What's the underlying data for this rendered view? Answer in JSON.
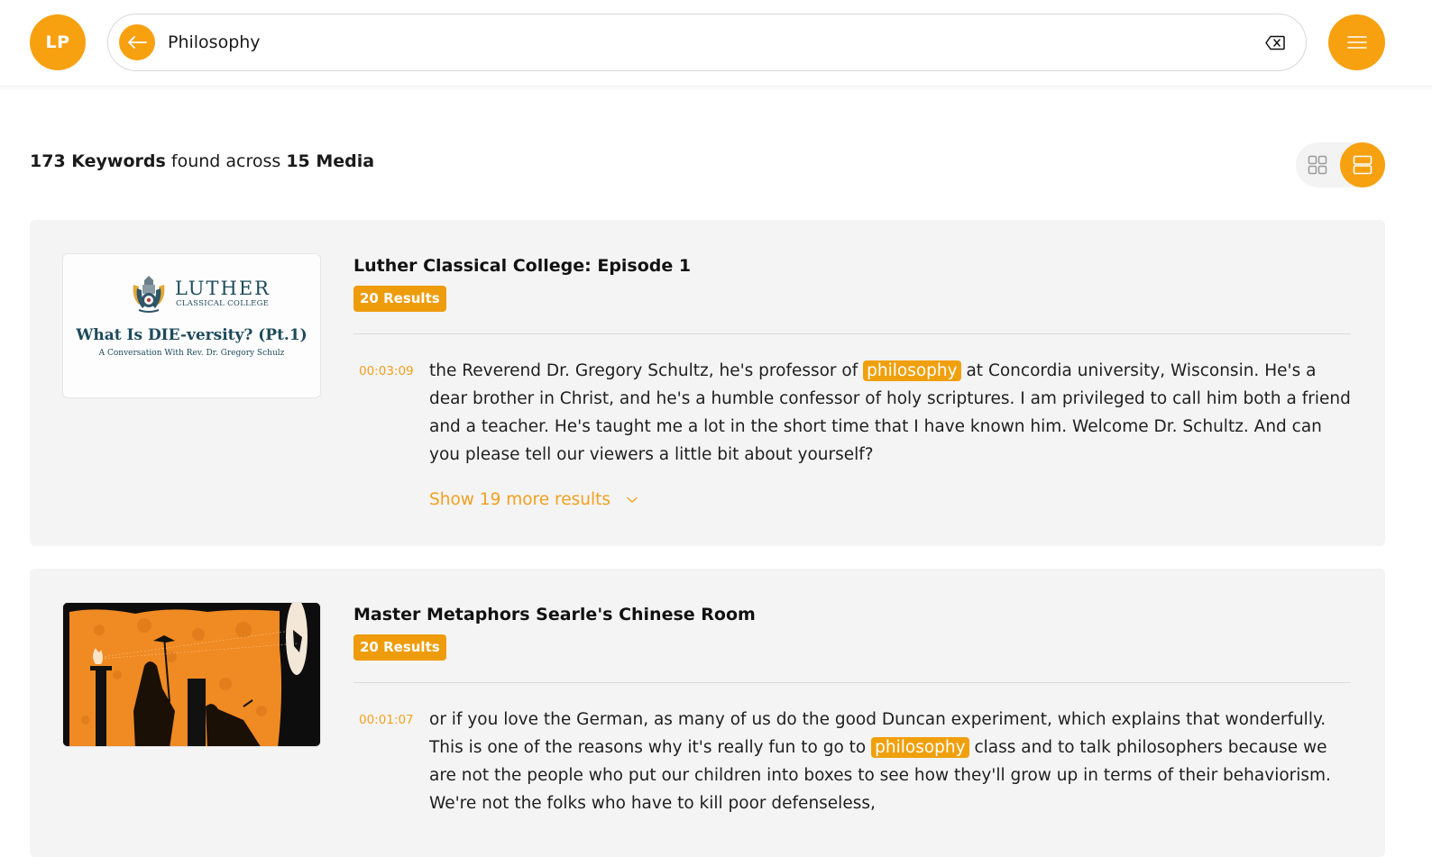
{
  "header": {
    "avatar_initials": "LP",
    "search": {
      "value": "Philosophy",
      "placeholder": "Search"
    },
    "icons": {
      "back": "arrow-left-icon",
      "clear": "backspace-x-icon",
      "menu": "hamburger-menu-icon"
    }
  },
  "summary": {
    "keywords_count": "173 Keywords",
    "middle_text": "found across",
    "media_count": "15 Media"
  },
  "view_toggle": {
    "options": [
      {
        "name": "grid",
        "icon": "grid-icon",
        "active": false
      },
      {
        "name": "list",
        "icon": "list-icon",
        "active": true
      }
    ]
  },
  "colors": {
    "accent": "#f7a111",
    "highlight": "#f0a00c",
    "card_bg": "#f4f4f4",
    "timestamp": "#f2a020"
  },
  "results": [
    {
      "title": "Luther Classical College: Episode 1",
      "badge": "20 Results",
      "thumbnail": {
        "brand": "LUTHER",
        "brand_sub": "CLASSICAL COLLEGE",
        "headline": "What Is DIE-versity? (Pt.1)",
        "subline": "A Conversation With Rev. Dr. Gregory Schulz"
      },
      "snippet": {
        "timestamp": "00:03:09",
        "before": "the Reverend Dr. Gregory Schultz, he's professor of ",
        "highlight": "philosophy",
        "after": " at Concordia university, Wisconsin. He's a dear brother in Christ, and he's a humble confessor of holy scriptures. I am privileged to call him both a friend and a teacher. He's taught me a lot in the short time that I have known him. Welcome Dr. Schultz. And can you please tell our viewers a little bit about yourself?"
      },
      "show_more": "Show 19 more results"
    },
    {
      "title": "Master Metaphors Searle's Chinese Room",
      "badge": "20 Results",
      "thumbnail": {
        "description": "illustrated-cave-scene"
      },
      "snippet": {
        "timestamp": "00:01:07",
        "before": "or if you love the German, as many of us do the good Duncan experiment, which explains that wonderfully. This is one of the reasons why it's really fun to go to ",
        "highlight": "philosophy",
        "after": " class and to talk philosophers because we are not the people who put our children into boxes to see how they'll grow up in terms of their behaviorism. We're not the folks who have to kill poor defenseless,"
      }
    }
  ]
}
